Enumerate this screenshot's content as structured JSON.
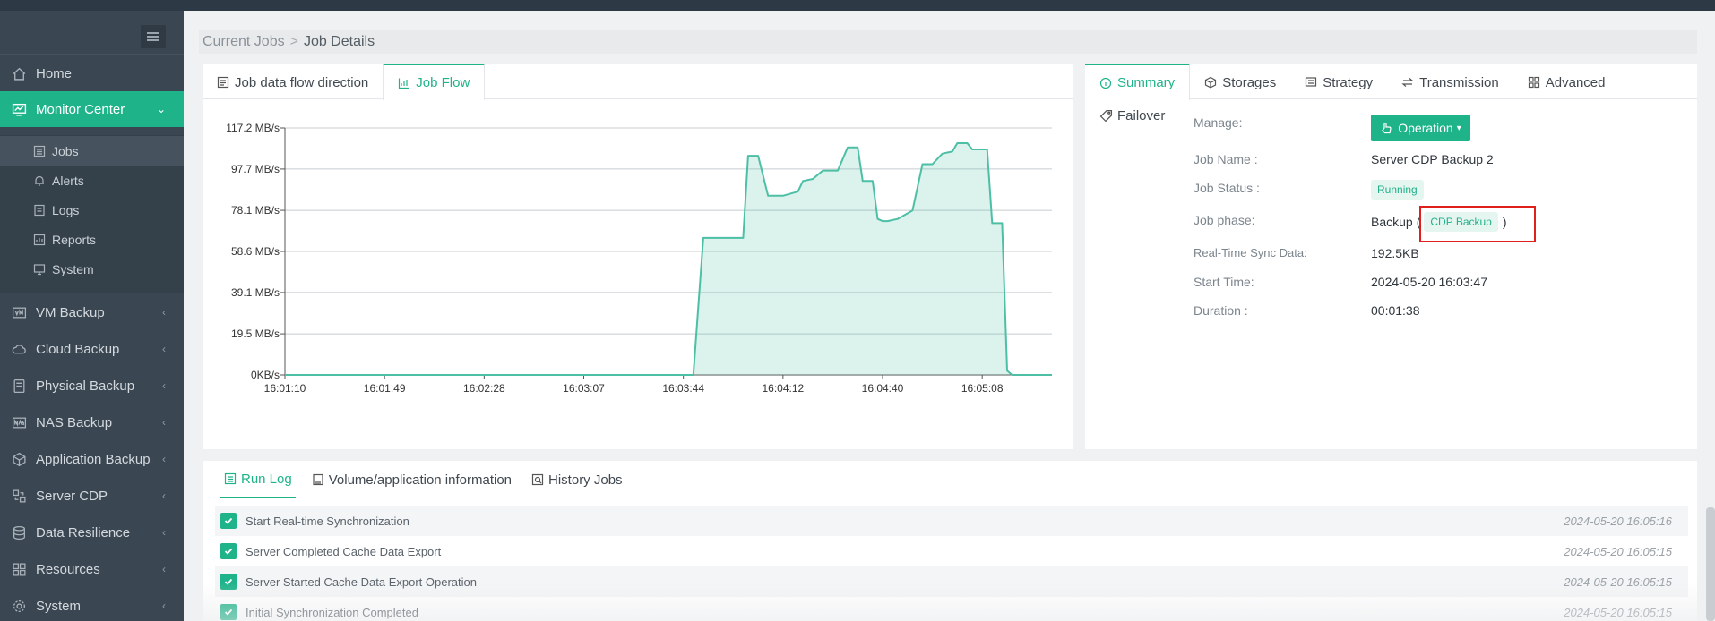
{
  "sidebar": {
    "items": [
      {
        "label": "Home",
        "icon": "home-icon"
      },
      {
        "label": "Monitor Center",
        "icon": "monitor-icon",
        "active": true
      },
      {
        "label": "VM Backup",
        "icon": "vm-icon"
      },
      {
        "label": "Cloud Backup",
        "icon": "cloud-icon"
      },
      {
        "label": "Physical Backup",
        "icon": "server-icon"
      },
      {
        "label": "NAS Backup",
        "icon": "nas-icon"
      },
      {
        "label": "Application Backup",
        "icon": "app-icon"
      },
      {
        "label": "Server CDP",
        "icon": "cdp-icon"
      },
      {
        "label": "Data Resilience",
        "icon": "database-icon"
      },
      {
        "label": "Resources",
        "icon": "grid-icon"
      },
      {
        "label": "System",
        "icon": "gear-icon"
      }
    ],
    "sub_items": [
      {
        "label": "Jobs",
        "icon": "list-icon",
        "selected": true
      },
      {
        "label": "Alerts",
        "icon": "bell-icon"
      },
      {
        "label": "Logs",
        "icon": "log-icon"
      },
      {
        "label": "Reports",
        "icon": "report-icon"
      },
      {
        "label": "System",
        "icon": "system-icon"
      }
    ]
  },
  "breadcrumb": {
    "parent": "Current Jobs",
    "separator": ">",
    "current": "Job Details"
  },
  "chart_panel": {
    "tabs": [
      {
        "label": "Job data flow direction",
        "icon": "flow-icon"
      },
      {
        "label": "Job Flow",
        "icon": "chart-icon",
        "active": true
      }
    ]
  },
  "chart_data": {
    "type": "area",
    "title": "",
    "xlabel": "",
    "ylabel": "",
    "y_ticks": [
      "0KB/s",
      "19.5 MB/s",
      "39.1 MB/s",
      "58.6 MB/s",
      "78.1 MB/s",
      "97.7 MB/s",
      "117.2 MB/s"
    ],
    "y_tick_values": [
      0,
      19.5,
      39.1,
      58.6,
      78.1,
      97.7,
      117.2
    ],
    "x_ticks": [
      "16:01:10",
      "16:01:49",
      "16:02:28",
      "16:03:07",
      "16:03:44",
      "16:04:12",
      "16:04:40",
      "16:05:08"
    ],
    "ylim": [
      0,
      117.2
    ],
    "x_max_tick_units": 7.7,
    "series": [
      {
        "color": "#4dbfa5",
        "x": [
          0,
          4.1,
          4.2,
          4.35,
          4.6,
          4.65,
          4.75,
          4.85,
          4.9,
          5.0,
          5.15,
          5.2,
          5.3,
          5.4,
          5.45,
          5.55,
          5.65,
          5.75,
          5.8,
          5.9,
          5.95,
          6.0,
          6.05,
          6.15,
          6.3,
          6.4,
          6.45,
          6.5,
          6.6,
          6.7,
          6.75,
          6.85,
          6.9,
          7.0,
          7.05,
          7.1,
          7.2,
          7.25,
          7.3,
          7.35,
          7.4,
          7.55,
          7.7
        ],
        "y": [
          0,
          0,
          65,
          65,
          65,
          104,
          104,
          85,
          85,
          85,
          87,
          92,
          93,
          97,
          97,
          97,
          108,
          108,
          92,
          92,
          74,
          73,
          73,
          74,
          78,
          100,
          100,
          100,
          105,
          106,
          110,
          110,
          107,
          107,
          107,
          72,
          72,
          2,
          0,
          0,
          0,
          0,
          0
        ]
      }
    ]
  },
  "summary_panel": {
    "tabs": [
      {
        "label": "Summary",
        "icon": "info-icon",
        "active": true
      },
      {
        "label": "Storages",
        "icon": "cube-icon"
      },
      {
        "label": "Strategy",
        "icon": "strategy-icon"
      },
      {
        "label": "Transmission",
        "icon": "transfer-icon"
      },
      {
        "label": "Advanced",
        "icon": "advanced-icon"
      }
    ],
    "failover_label": "Failover",
    "manage_label": "Manage:",
    "operation_button": "Operation",
    "fields": {
      "job_name_label": "Job Name :",
      "job_name": "Server CDP Backup 2",
      "job_status_label": "Job Status :",
      "job_status": "Running",
      "job_phase_label": "Job phase:",
      "job_phase": "Backup",
      "job_phase_open": "(",
      "job_phase_badge": "CDP Backup",
      "job_phase_close": ")",
      "sync_label": "Real-Time Sync Data:",
      "sync_value": "192.5KB",
      "start_label": "Start Time:",
      "start_value": "2024-05-20 16:03:47",
      "duration_label": "Duration :",
      "duration_value": "00:01:38"
    }
  },
  "bottom_panel": {
    "tabs": [
      {
        "label": "Run Log",
        "icon": "runlog-icon",
        "active": true
      },
      {
        "label": "Volume/application information",
        "icon": "volume-icon"
      },
      {
        "label": "History Jobs",
        "icon": "history-icon"
      }
    ],
    "logs": [
      {
        "text": "Start Real-time Synchronization",
        "time": "2024-05-20 16:05:16"
      },
      {
        "text": "Server Completed Cache Data Export",
        "time": "2024-05-20 16:05:15"
      },
      {
        "text": "Server Started Cache Data Export Operation",
        "time": "2024-05-20 16:05:15"
      },
      {
        "text": "Initial Synchronization Completed",
        "time": "2024-05-20 16:05:15"
      }
    ]
  },
  "colors": {
    "accent": "#1fb38a",
    "sidebar": "#3a4651",
    "highlight": "#e0201b"
  }
}
